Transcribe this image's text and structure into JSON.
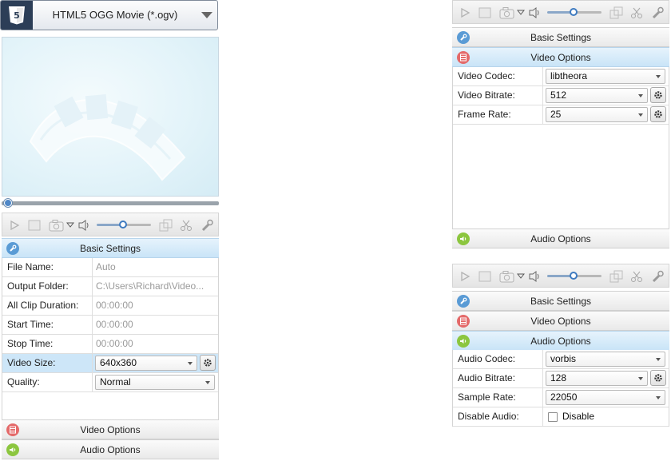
{
  "format": {
    "label": "HTML5 OGG Movie (*.ogv)",
    "icon": "html5-icon"
  },
  "sections": {
    "basic": "Basic Settings",
    "video": "Video Options",
    "audio": "Audio Options"
  },
  "basic_settings": [
    {
      "key": "File Name:",
      "value": "Auto"
    },
    {
      "key": "Output Folder:",
      "value": "C:\\Users\\Richard\\Video..."
    },
    {
      "key": "All Clip Duration:",
      "value": "00:00:00"
    },
    {
      "key": "Start Time:",
      "value": "00:00:00"
    },
    {
      "key": "Stop Time:",
      "value": "00:00:00"
    },
    {
      "key": "Video Size:",
      "value": "640x360"
    },
    {
      "key": "Quality:",
      "value": "Normal"
    }
  ],
  "video_options": [
    {
      "key": "Video Codec:",
      "value": "libtheora"
    },
    {
      "key": "Video Bitrate:",
      "value": "512"
    },
    {
      "key": "Frame Rate:",
      "value": "25"
    }
  ],
  "audio_options": [
    {
      "key": "Audio Codec:",
      "value": "vorbis"
    },
    {
      "key": "Audio Bitrate:",
      "value": "128"
    },
    {
      "key": "Sample Rate:",
      "value": "22050"
    },
    {
      "key": "Disable Audio:",
      "value": "Disable"
    }
  ],
  "colors": {
    "accent": "#3f7bc0",
    "html5_badge": "#2c3e57",
    "video_icon": "#e46a6a",
    "audio_icon": "#8cc63f",
    "basic_icon": "#5a9bd5"
  },
  "playback": {
    "seek_progress": 0.02,
    "volume_level": 0.3
  }
}
